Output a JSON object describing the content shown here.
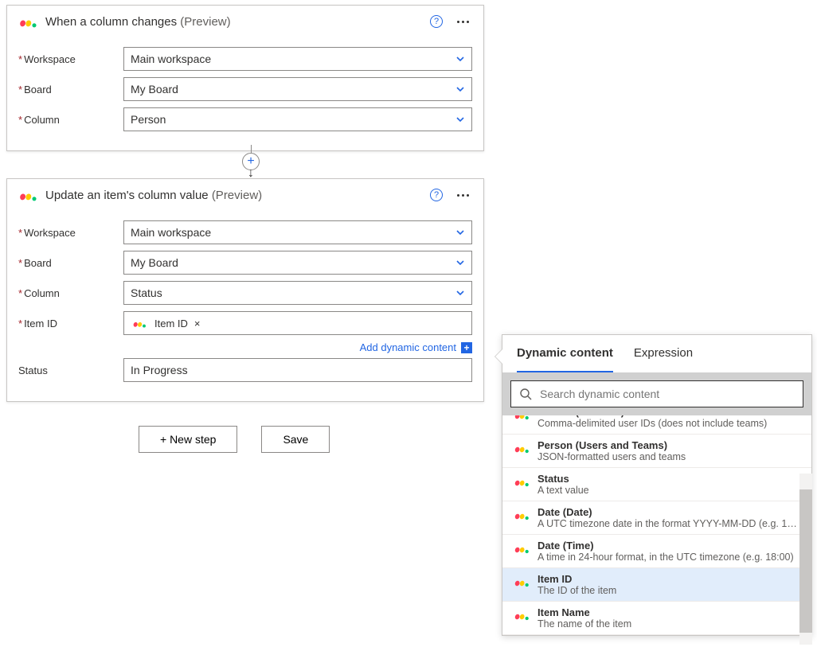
{
  "trigger": {
    "title": "When a column changes",
    "preview": "(Preview)",
    "workspace_label": "Workspace",
    "workspace_value": "Main workspace",
    "board_label": "Board",
    "board_value": "My Board",
    "column_label": "Column",
    "column_value": "Person"
  },
  "action": {
    "title": "Update an item's column value",
    "preview": "(Preview)",
    "workspace_label": "Workspace",
    "workspace_value": "Main workspace",
    "board_label": "Board",
    "board_value": "My Board",
    "column_label": "Column",
    "column_value": "Status",
    "itemid_label": "Item ID",
    "itemid_token": "Item ID",
    "add_dynamic": "Add dynamic content",
    "status_label": "Status",
    "status_value": "In Progress"
  },
  "buttons": {
    "new_step": "+ New step",
    "save": "Save"
  },
  "dc": {
    "tab_dynamic": "Dynamic content",
    "tab_expression": "Expression",
    "search_placeholder": "Search dynamic content",
    "items": [
      {
        "name": "Person (User IDs)",
        "desc": "Comma-delimited user IDs (does not include teams)",
        "cut": true
      },
      {
        "name": "Person (Users and Teams)",
        "desc": "JSON-formatted users and teams"
      },
      {
        "name": "Status",
        "desc": "A text value"
      },
      {
        "name": "Date (Date)",
        "desc": "A UTC timezone date in the format YYYY-MM-DD (e.g. 19…"
      },
      {
        "name": "Date (Time)",
        "desc": "A time in 24-hour format, in the UTC timezone (e.g. 18:00)"
      },
      {
        "name": "Item ID",
        "desc": "The ID of the item",
        "selected": true
      },
      {
        "name": "Item Name",
        "desc": "The name of the item"
      }
    ]
  }
}
